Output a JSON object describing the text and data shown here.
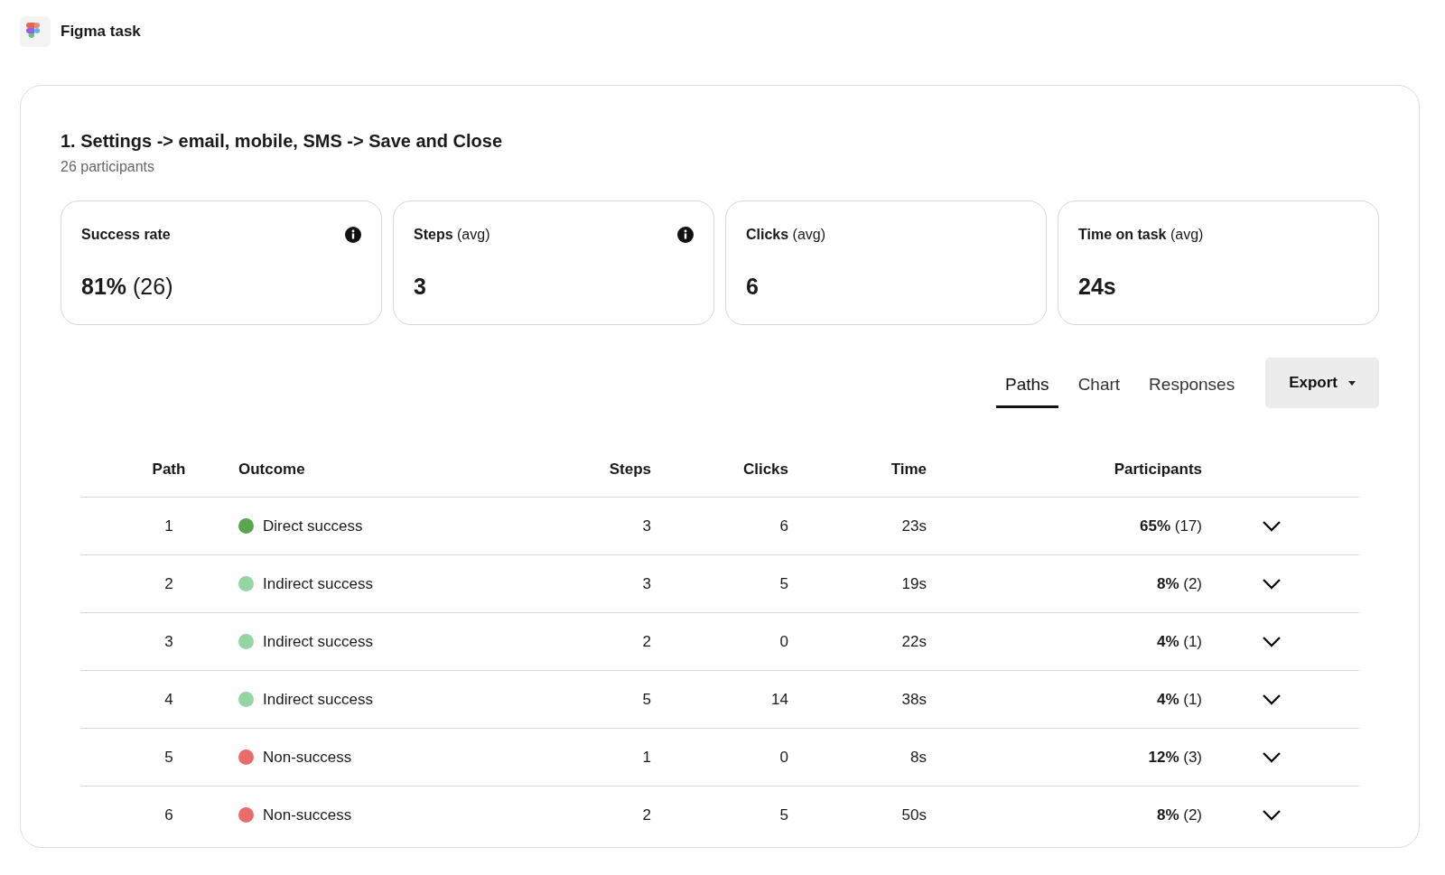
{
  "header": {
    "title": "Figma task"
  },
  "task": {
    "title": "1. Settings -> email, mobile, SMS -> Save and Close",
    "subtitle": "26 participants"
  },
  "metrics": [
    {
      "label": "**Success rate**",
      "value": "**81%** (26)",
      "info": true
    },
    {
      "label": "**Steps** (avg)",
      "value": "**3**",
      "info": true
    },
    {
      "label": "**Clicks** (avg)",
      "value": "**6**",
      "info": false
    },
    {
      "label": "**Time on task** (avg)",
      "value": "**24s**",
      "info": false
    }
  ],
  "tabs": [
    {
      "label": "Paths",
      "selected": true
    },
    {
      "label": "Chart",
      "selected": false
    },
    {
      "label": "Responses",
      "selected": false
    }
  ],
  "export_button": {
    "label": "Export"
  },
  "table": {
    "columns": [
      "Path",
      "Outcome",
      "Steps",
      "Clicks",
      "Time",
      "Participants"
    ],
    "rows": [
      {
        "path": "1",
        "outcome": "Direct success",
        "color": "#5aa64f",
        "steps": "3",
        "clicks": "6",
        "time": "23s",
        "participants": "**65%** (17)"
      },
      {
        "path": "2",
        "outcome": "Indirect success",
        "color": "#95d4a4",
        "steps": "3",
        "clicks": "5",
        "time": "19s",
        "participants": "**8%** (2)"
      },
      {
        "path": "3",
        "outcome": "Indirect success",
        "color": "#95d4a4",
        "steps": "2",
        "clicks": "0",
        "time": "22s",
        "participants": "**4%** (1)"
      },
      {
        "path": "4",
        "outcome": "Indirect success",
        "color": "#95d4a4",
        "steps": "5",
        "clicks": "14",
        "time": "38s",
        "participants": "**4%** (1)"
      },
      {
        "path": "5",
        "outcome": "Non-success",
        "color": "#e96b6b",
        "steps": "1",
        "clicks": "0",
        "time": "8s",
        "participants": "**12%** (3)"
      },
      {
        "path": "6",
        "outcome": "Non-success",
        "color": "#e96b6b",
        "steps": "2",
        "clicks": "5",
        "time": "50s",
        "participants": "**8%** (2)"
      }
    ]
  }
}
